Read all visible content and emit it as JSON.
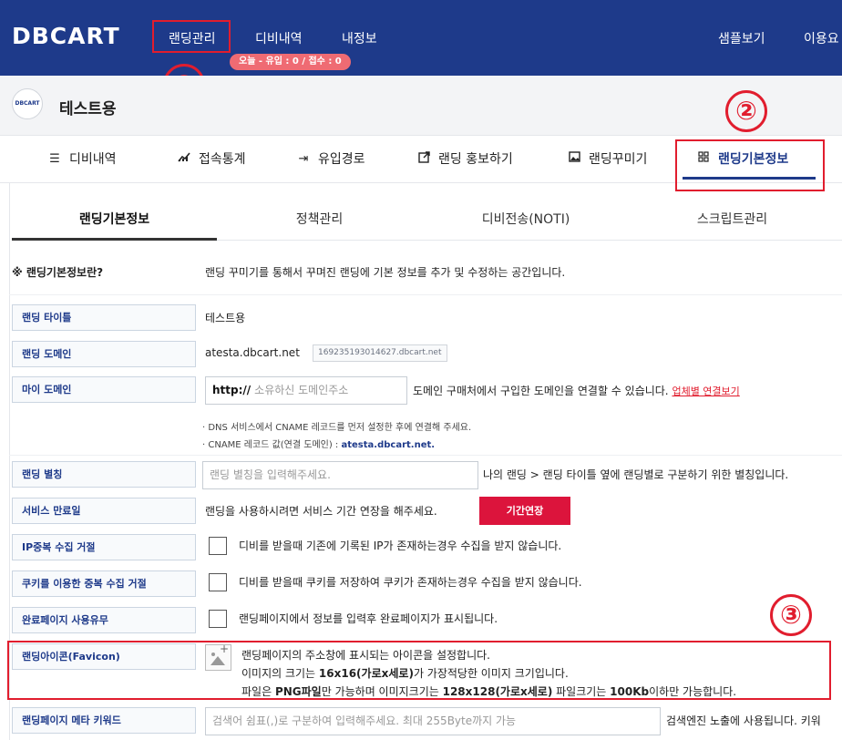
{
  "header": {
    "logo": "DBCART",
    "nav": [
      "랜딩관리",
      "디비내역",
      "내정보"
    ],
    "stats_pill": "오늘 - 유입 : 0 / 접수 : 0",
    "right_links": [
      "샘플보기",
      "이용요"
    ]
  },
  "markers": [
    "①",
    "②",
    "③"
  ],
  "account": {
    "logo_text": "DBCART",
    "name": "테스트용"
  },
  "main_tabs": [
    {
      "icon": "list-icon",
      "label": "디비내역"
    },
    {
      "icon": "chart-icon",
      "label": "접속통계"
    },
    {
      "icon": "entry-icon",
      "label": "유입경로"
    },
    {
      "icon": "external-icon",
      "label": "랜딩 홍보하기"
    },
    {
      "icon": "image-icon",
      "label": "랜딩꾸미기"
    },
    {
      "icon": "grid-icon",
      "label": "랜딩기본정보"
    }
  ],
  "sub_tabs": [
    "랜딩기본정보",
    "정책관리",
    "디비전송(NOTI)",
    "스크립트관리"
  ],
  "intro": {
    "label": "※ 랜딩기본정보란?",
    "text": "랜딩 꾸미기를 통해서 꾸며진 랜딩에 기본 정보를 추가 및 수정하는 공간입니다."
  },
  "rows": {
    "title": {
      "label": "랜딩 타이틀",
      "value": "테스트용"
    },
    "domain": {
      "label": "랜딩 도메인",
      "value": "atesta.dbcart.net",
      "badge": "169235193014627.dbcart.net"
    },
    "my_domain": {
      "label": "마이 도메인",
      "prefix": "http://",
      "placeholder": "소유하신 도메인주소",
      "desc": "도메인 구매처에서 구입한 도메인을 연결할 수 있습니다.",
      "link": "업체별 연결보기",
      "note1": "· DNS 서비스에서 CNAME 레코드를 먼저 설정한 후에 연결해 주세요.",
      "note2_prefix": "· CNAME 레코드 값(연결 도메인) : ",
      "note2_value": "atesta.dbcart.net."
    },
    "alias": {
      "label": "랜딩 별칭",
      "placeholder": "랜딩 별칭을 입력해주세요.",
      "desc": "나의 랜딩 > 랜딩 타이틀 옆에 랜딩별로 구분하기 위한 별칭입니다."
    },
    "expiry": {
      "label": "서비스 만료일",
      "desc": "랜딩을 사용하시려면 서비스 기간 연장을 해주세요.",
      "button": "기간연장"
    },
    "ip_dup": {
      "label": "IP중복 수집 거절",
      "desc": "디비를 받을때 기존에 기록된 IP가 존재하는경우 수집을 받지 않습니다."
    },
    "cookie_dup": {
      "label": "쿠키를 이용한 중복 수집 거절",
      "desc": "디비를 받을때 쿠키를 저장하여 쿠키가 존재하는경우 수집을 받지 않습니다."
    },
    "complete_page": {
      "label": "완료페이지 사용유무",
      "desc": "랜딩페이지에서 정보를 입력후 완료페이지가 표시됩니다."
    },
    "favicon": {
      "label": "랜딩아이콘(Favicon)",
      "line1": "랜딩페이지의 주소창에 표시되는 아이콘을 설정합니다.",
      "line2_a": "이미지의 크기는 ",
      "line2_b": "16x16(가로x세로)",
      "line2_c": "가 가장적당한 이미지 크기입니다.",
      "line3_a": "파일은 ",
      "line3_b": "PNG파일",
      "line3_c": "만 가능하며 이미지크기는 ",
      "line3_d": "128x128(가로x세로)",
      "line3_e": " 파일크기는 ",
      "line3_f": "100Kb",
      "line3_g": "이하만 가능합니다."
    },
    "meta": {
      "label": "랜딩페이지 메타 키워드",
      "placeholder": "검색어 쉼표(,)로 구분하여 입력해주세요. 최대 255Byte까지 가능",
      "desc": "검색엔진 노출에 사용됩니다. 키워"
    }
  },
  "colors": {
    "header_bg": "#1e3a8a",
    "accent_red": "#e11d2e",
    "button_red": "#dc143c",
    "pill": "#ef6b73"
  }
}
